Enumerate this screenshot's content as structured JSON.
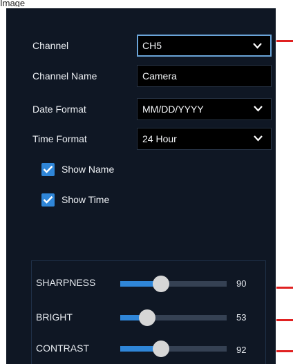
{
  "top_fragment": "Image",
  "channel": {
    "label": "Channel",
    "value": "CH5",
    "icon": "chevron-down-icon"
  },
  "channel_name": {
    "label": "Channel Name",
    "value": "Camera"
  },
  "date_format": {
    "label": "Date Format",
    "value": "MM/DD/YYYY",
    "icon": "chevron-down-icon"
  },
  "time_format": {
    "label": "Time Format",
    "value": "24 Hour",
    "icon": "chevron-down-icon"
  },
  "show_name": {
    "label": "Show Name",
    "checked": true
  },
  "show_time": {
    "label": "Show Time",
    "checked": true
  },
  "sliders": {
    "sharpness": {
      "label": "SHARPNESS",
      "value": "90",
      "level": 0.38
    },
    "bright": {
      "label": "BRIGHT",
      "value": "53",
      "level": 0.25
    },
    "contrast": {
      "label": "CONTRAST",
      "value": "92",
      "level": 0.38
    }
  },
  "colors": {
    "panel": "#0f1724",
    "accent": "#2f86d8",
    "marker": "#e02121",
    "active_border": "#6aa4d8"
  }
}
